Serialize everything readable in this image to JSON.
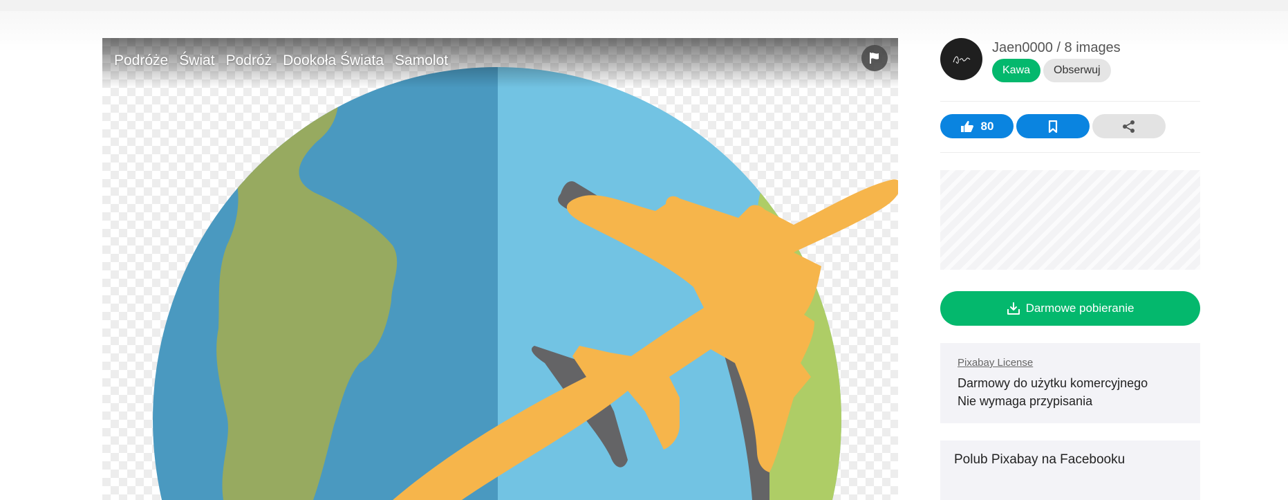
{
  "viewer": {
    "tags": [
      {
        "label": "Podróże"
      },
      {
        "label": "Świat"
      },
      {
        "label": "Podróż"
      },
      {
        "label": "Dookoła Świata"
      },
      {
        "label": "Samolot"
      }
    ],
    "flag_icon": "flag-icon"
  },
  "author": {
    "name_line": "Jaen0000 / 8 images",
    "coffee_label": "Kawa",
    "follow_label": "Obserwuj"
  },
  "actions": {
    "like_count": "80",
    "like_icon": "thumbs-up-icon",
    "bookmark_icon": "bookmark-icon",
    "share_icon": "share-icon"
  },
  "download": {
    "label": "Darmowe pobieranie",
    "icon": "download-icon"
  },
  "license": {
    "link": "Pixabay License",
    "line1": "Darmowy do użytku komercyjnego",
    "line2": "Nie wymaga przypisania"
  },
  "facebook": {
    "title": "Polub Pixabay na Facebooku"
  },
  "colors": {
    "green": "#04b86d",
    "blue": "#0a84e0",
    "globe_dark": "#4a99c0",
    "globe_light": "#72c3e3",
    "land_dark": "#97aa60",
    "land_light": "#aecd66",
    "plane": "#f6b54b",
    "plane_shadow": "#646466"
  }
}
